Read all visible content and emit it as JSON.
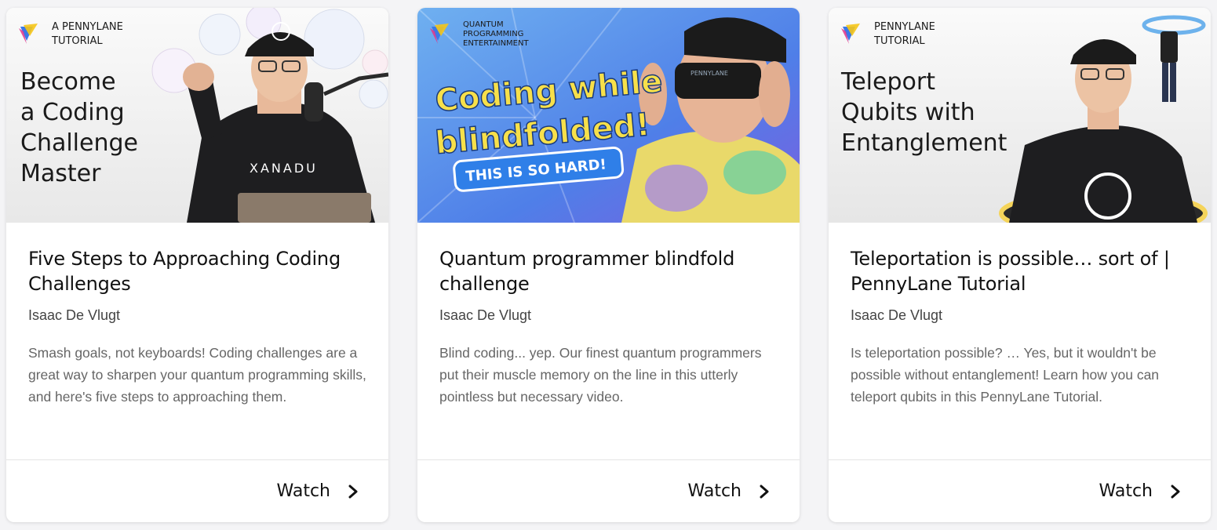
{
  "cards": [
    {
      "thumbnail": {
        "brand_line1": "A PENNYLANE",
        "brand_line2": "TUTORIAL",
        "headline": [
          "Become",
          "a Coding",
          "Challenge",
          "Master"
        ],
        "shirt_text": "XANADU"
      },
      "title": "Five Steps to Approaching Coding Challenges",
      "author": "Isaac De Vlugt",
      "description": "Smash goals, not keyboards! Coding challenges are a great way to sharpen your quantum programming skills, and here's five steps to approaching them.",
      "action": "Watch"
    },
    {
      "thumbnail": {
        "brand_line1": "QUANTUM",
        "brand_line2": "PROGRAMMING",
        "brand_line3": "ENTERTAINMENT",
        "headline": [
          "Coding while",
          "blindfolded!"
        ],
        "sub_banner": "THIS IS SO HARD!",
        "mask_text": "PENNYLANE"
      },
      "title": "Quantum programmer blindfold challenge",
      "author": "Isaac De Vlugt",
      "description": "Blind coding... yep. Our finest quantum programmers put their muscle memory on the line in this utterly pointless but necessary video.",
      "action": "Watch"
    },
    {
      "thumbnail": {
        "brand_line1": "PENNYLANE",
        "brand_line2": "TUTORIAL",
        "headline": [
          "Teleport",
          "Qubits with",
          "Entanglement"
        ]
      },
      "title": "Teleportation is possible… sort of | PennyLane Tutorial",
      "author": "Isaac De Vlugt",
      "description": "Is teleportation possible? … Yes, but it wouldn't be possible without entanglement! Learn how you can teleport qubits in this PennyLane Tutorial.",
      "action": "Watch"
    }
  ],
  "colors": {
    "background": "#f4f4f6",
    "card": "#ffffff",
    "title": "#111111",
    "description": "#666666",
    "blue_bg": "#4f7fe8",
    "yellow_text": "#f7e04a"
  },
  "icons": {
    "logo": "pennylane-logo-icon",
    "chevron": "chevron-right-icon"
  }
}
